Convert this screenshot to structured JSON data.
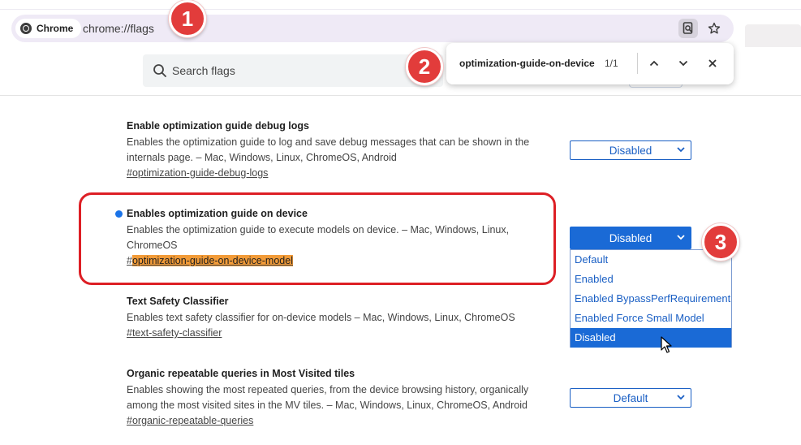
{
  "browser": {
    "chip_label": "Chrome",
    "url": "chrome://flags"
  },
  "search": {
    "placeholder": "Search flags"
  },
  "find_bar": {
    "query": "optimization-guide-on-device",
    "count": "1/1"
  },
  "flags": [
    {
      "title": "Enable optimization guide debug logs",
      "description": "Enables the optimization guide to log and save debug messages that can be shown in the internals page. – Mac, Windows, Linux, ChromeOS, Android",
      "link": "#optimization-guide-debug-logs",
      "value": "Disabled"
    },
    {
      "title": "Enables optimization guide on device",
      "description": "Enables the optimization guide to execute models on device. – Mac, Windows, Linux, ChromeOS",
      "link_hash": "#",
      "link_match": "optimization-guide-on-device-model",
      "value": "Disabled",
      "modified": true
    },
    {
      "title": "Text Safety Classifier",
      "description": "Enables text safety classifier for on-device models – Mac, Windows, Linux, ChromeOS",
      "link": "#text-safety-classifier"
    },
    {
      "title": "Organic repeatable queries in Most Visited tiles",
      "description": "Enables showing the most repeated queries, from the device browsing history, organically among the most visited sites in the MV tiles. – Mac, Windows, Linux, ChromeOS, Android",
      "link": "#organic-repeatable-queries",
      "value": "Default"
    }
  ],
  "dropdown_options": [
    "Default",
    "Enabled",
    "Enabled BypassPerfRequirement",
    "Enabled Force Small Model",
    "Disabled"
  ],
  "dropdown_selected": "Disabled",
  "step_badges": [
    "1",
    "2",
    "3"
  ],
  "colors": {
    "accent": "#1a73e8",
    "select_blue": "#1a6ad6",
    "annotation_red": "#dd1f25",
    "match_highlight": "#f29b38"
  }
}
